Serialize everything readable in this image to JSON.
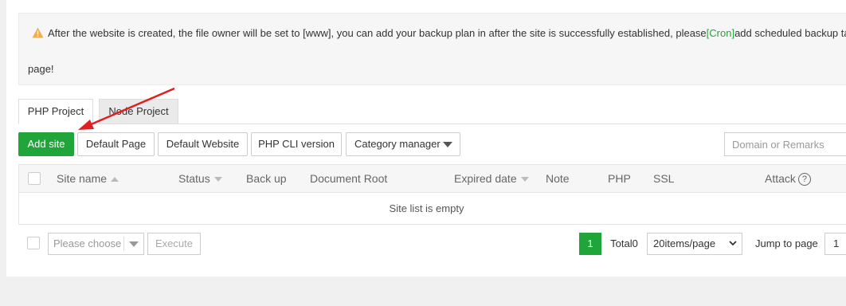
{
  "notice": {
    "text_before": "After the website is created, the file owner will be set to [www], you can add your backup plan in after the site is successfully established, please",
    "cron_link": "[Cron]",
    "text_after": "add scheduled backup ta",
    "line2": "page!",
    "icon": "warning-icon"
  },
  "tabs": [
    {
      "label": "PHP Project",
      "active": true
    },
    {
      "label": "Node Project",
      "active": false
    }
  ],
  "toolbar": {
    "add_site": "Add site",
    "default_page": "Default Page",
    "default_website": "Default Website",
    "php_cli": "PHP CLI version",
    "category_manager": "Category manager"
  },
  "search": {
    "placeholder": "Domain or Remarks"
  },
  "table": {
    "columns": {
      "site_name": "Site name",
      "status": "Status",
      "backup": "Back up",
      "document_root": "Document Root",
      "expired_date": "Expired date",
      "note": "Note",
      "php": "PHP",
      "ssl": "SSL",
      "attack": "Attack"
    },
    "empty_message": "Site list is empty"
  },
  "batch": {
    "placeholder": "Please choose",
    "execute": "Execute"
  },
  "pagination": {
    "current_page": "1",
    "total": "Total0",
    "per_page": "20items/page",
    "jump_label": "Jump to page",
    "jump_value": "1"
  },
  "colors": {
    "accent": "#20a53a",
    "warning": "#f0ad4e",
    "annotation_arrow": "#e02020"
  }
}
